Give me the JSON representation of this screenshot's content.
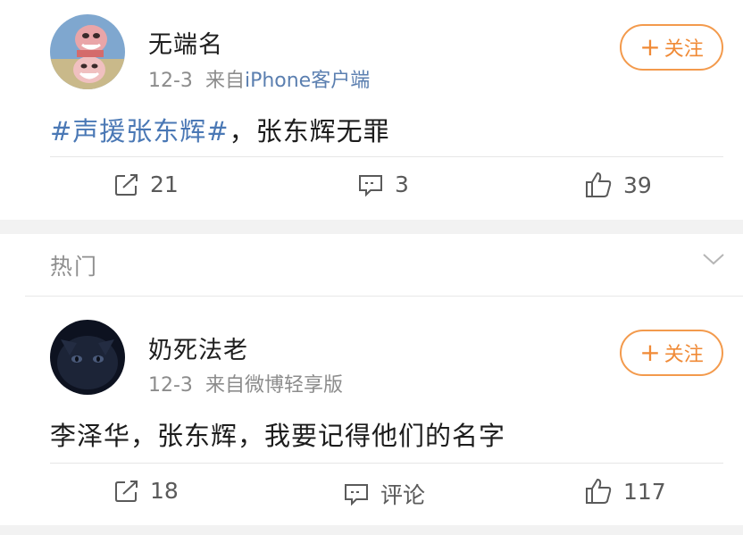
{
  "posts": [
    {
      "username": "无端名",
      "date": "12-3",
      "source_prefix": "来自",
      "source_link": "iPhone客户端",
      "source_rest": "",
      "follow_label": "关注",
      "content_topic": "#声援张东辉#",
      "content_text": "，张东辉无罪",
      "repost_count": "21",
      "comment_count": "3",
      "like_count": "39",
      "avatar_icon": "cartoon-face-avatar"
    },
    {
      "username": "奶死法老",
      "date": "12-3",
      "source_prefix": "来自微博轻享版",
      "source_link": "",
      "source_rest": "",
      "follow_label": "关注",
      "content_topic": "",
      "content_text": "李泽华，张东辉，我要记得他们的名字",
      "repost_count": "18",
      "comment_count": "评论",
      "like_count": "117",
      "avatar_icon": "dark-cat-avatar"
    }
  ],
  "section": {
    "hot_label": "热门"
  },
  "colors": {
    "accent_orange": "#f08a36",
    "link_blue": "#4a78b5",
    "meta_gray": "#8c8c8c",
    "gap_gray": "#f2f2f2"
  },
  "icons": [
    "repost-icon",
    "comment-icon",
    "like-icon",
    "chevron-down-icon",
    "plus-icon"
  ]
}
